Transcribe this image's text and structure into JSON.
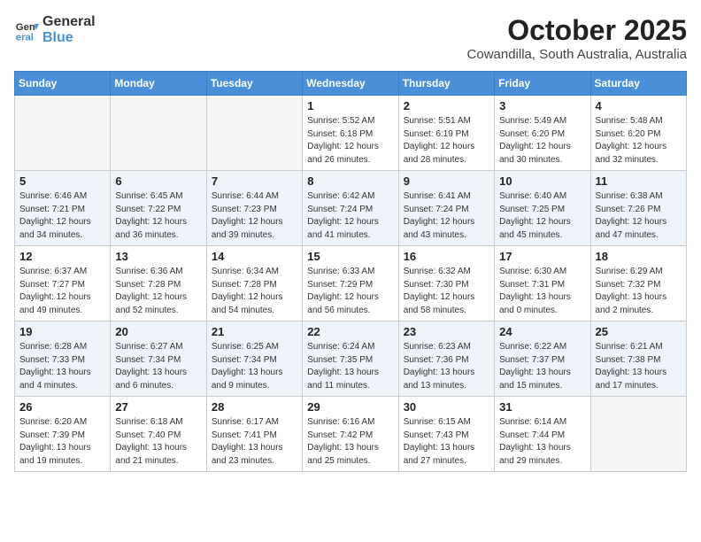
{
  "logo": {
    "line1": "General",
    "line2": "Blue"
  },
  "title": "October 2025",
  "subtitle": "Cowandilla, South Australia, Australia",
  "days_of_week": [
    "Sunday",
    "Monday",
    "Tuesday",
    "Wednesday",
    "Thursday",
    "Friday",
    "Saturday"
  ],
  "weeks": [
    [
      {
        "day": "",
        "content": ""
      },
      {
        "day": "",
        "content": ""
      },
      {
        "day": "",
        "content": ""
      },
      {
        "day": "1",
        "content": "Sunrise: 5:52 AM\nSunset: 6:18 PM\nDaylight: 12 hours\nand 26 minutes."
      },
      {
        "day": "2",
        "content": "Sunrise: 5:51 AM\nSunset: 6:19 PM\nDaylight: 12 hours\nand 28 minutes."
      },
      {
        "day": "3",
        "content": "Sunrise: 5:49 AM\nSunset: 6:20 PM\nDaylight: 12 hours\nand 30 minutes."
      },
      {
        "day": "4",
        "content": "Sunrise: 5:48 AM\nSunset: 6:20 PM\nDaylight: 12 hours\nand 32 minutes."
      }
    ],
    [
      {
        "day": "5",
        "content": "Sunrise: 6:46 AM\nSunset: 7:21 PM\nDaylight: 12 hours\nand 34 minutes."
      },
      {
        "day": "6",
        "content": "Sunrise: 6:45 AM\nSunset: 7:22 PM\nDaylight: 12 hours\nand 36 minutes."
      },
      {
        "day": "7",
        "content": "Sunrise: 6:44 AM\nSunset: 7:23 PM\nDaylight: 12 hours\nand 39 minutes."
      },
      {
        "day": "8",
        "content": "Sunrise: 6:42 AM\nSunset: 7:24 PM\nDaylight: 12 hours\nand 41 minutes."
      },
      {
        "day": "9",
        "content": "Sunrise: 6:41 AM\nSunset: 7:24 PM\nDaylight: 12 hours\nand 43 minutes."
      },
      {
        "day": "10",
        "content": "Sunrise: 6:40 AM\nSunset: 7:25 PM\nDaylight: 12 hours\nand 45 minutes."
      },
      {
        "day": "11",
        "content": "Sunrise: 6:38 AM\nSunset: 7:26 PM\nDaylight: 12 hours\nand 47 minutes."
      }
    ],
    [
      {
        "day": "12",
        "content": "Sunrise: 6:37 AM\nSunset: 7:27 PM\nDaylight: 12 hours\nand 49 minutes."
      },
      {
        "day": "13",
        "content": "Sunrise: 6:36 AM\nSunset: 7:28 PM\nDaylight: 12 hours\nand 52 minutes."
      },
      {
        "day": "14",
        "content": "Sunrise: 6:34 AM\nSunset: 7:28 PM\nDaylight: 12 hours\nand 54 minutes."
      },
      {
        "day": "15",
        "content": "Sunrise: 6:33 AM\nSunset: 7:29 PM\nDaylight: 12 hours\nand 56 minutes."
      },
      {
        "day": "16",
        "content": "Sunrise: 6:32 AM\nSunset: 7:30 PM\nDaylight: 12 hours\nand 58 minutes."
      },
      {
        "day": "17",
        "content": "Sunrise: 6:30 AM\nSunset: 7:31 PM\nDaylight: 13 hours\nand 0 minutes."
      },
      {
        "day": "18",
        "content": "Sunrise: 6:29 AM\nSunset: 7:32 PM\nDaylight: 13 hours\nand 2 minutes."
      }
    ],
    [
      {
        "day": "19",
        "content": "Sunrise: 6:28 AM\nSunset: 7:33 PM\nDaylight: 13 hours\nand 4 minutes."
      },
      {
        "day": "20",
        "content": "Sunrise: 6:27 AM\nSunset: 7:34 PM\nDaylight: 13 hours\nand 6 minutes."
      },
      {
        "day": "21",
        "content": "Sunrise: 6:25 AM\nSunset: 7:34 PM\nDaylight: 13 hours\nand 9 minutes."
      },
      {
        "day": "22",
        "content": "Sunrise: 6:24 AM\nSunset: 7:35 PM\nDaylight: 13 hours\nand 11 minutes."
      },
      {
        "day": "23",
        "content": "Sunrise: 6:23 AM\nSunset: 7:36 PM\nDaylight: 13 hours\nand 13 minutes."
      },
      {
        "day": "24",
        "content": "Sunrise: 6:22 AM\nSunset: 7:37 PM\nDaylight: 13 hours\nand 15 minutes."
      },
      {
        "day": "25",
        "content": "Sunrise: 6:21 AM\nSunset: 7:38 PM\nDaylight: 13 hours\nand 17 minutes."
      }
    ],
    [
      {
        "day": "26",
        "content": "Sunrise: 6:20 AM\nSunset: 7:39 PM\nDaylight: 13 hours\nand 19 minutes."
      },
      {
        "day": "27",
        "content": "Sunrise: 6:18 AM\nSunset: 7:40 PM\nDaylight: 13 hours\nand 21 minutes."
      },
      {
        "day": "28",
        "content": "Sunrise: 6:17 AM\nSunset: 7:41 PM\nDaylight: 13 hours\nand 23 minutes."
      },
      {
        "day": "29",
        "content": "Sunrise: 6:16 AM\nSunset: 7:42 PM\nDaylight: 13 hours\nand 25 minutes."
      },
      {
        "day": "30",
        "content": "Sunrise: 6:15 AM\nSunset: 7:43 PM\nDaylight: 13 hours\nand 27 minutes."
      },
      {
        "day": "31",
        "content": "Sunrise: 6:14 AM\nSunset: 7:44 PM\nDaylight: 13 hours\nand 29 minutes."
      },
      {
        "day": "",
        "content": ""
      }
    ]
  ]
}
